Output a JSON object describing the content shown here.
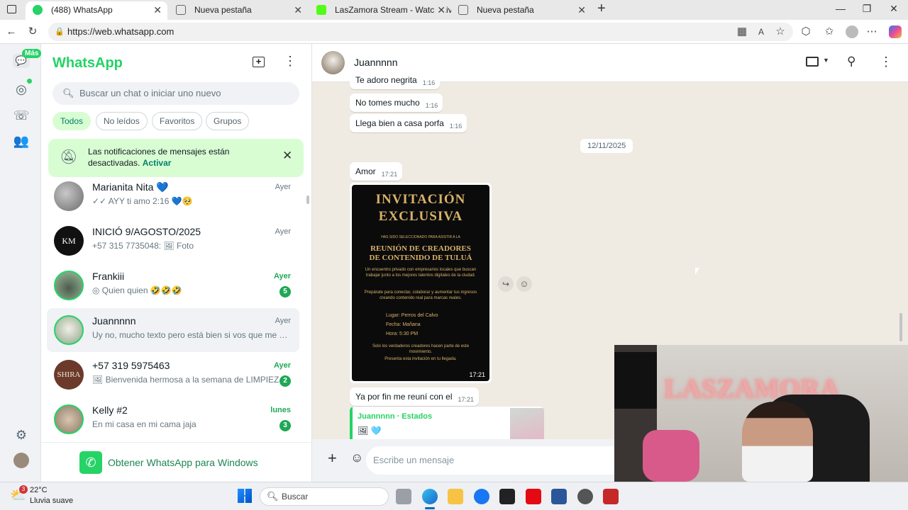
{
  "browser": {
    "tabs": [
      {
        "title": "(488) WhatsApp",
        "active": true,
        "favicon": "whatsapp-favicon"
      },
      {
        "title": "Nueva pestaña",
        "active": false,
        "favicon": "edge-page-favicon"
      },
      {
        "title": "LasZamora Stream - Watch Live o",
        "active": false,
        "favicon": "kick-favicon"
      },
      {
        "title": "Nueva pestaña",
        "active": false,
        "favicon": "edge-page-favicon"
      }
    ],
    "new_tab_label": "+",
    "url": "https://web.whatsapp.com"
  },
  "rail": {
    "mas_badge": "Más"
  },
  "sidebar": {
    "brand": "WhatsApp",
    "search_placeholder": "Buscar un chat o iniciar uno nuevo",
    "filters": [
      "Todos",
      "No leídos",
      "Favoritos",
      "Grupos"
    ],
    "notification": {
      "text": "Las notificaciones de mensajes están desactivadas.",
      "action": "Activar"
    },
    "chats": [
      {
        "name": "Marianita Nita 💙",
        "preview": "✓✓ AYY ti amo 2:16 💙🥺",
        "time": "Ayer",
        "unread": null,
        "selected": false,
        "avatar_color": "#8a8a8a"
      },
      {
        "name": "INICIÓ 9/AGOSTO/2025",
        "preview": "+57 315 7735048: 🖼 Foto",
        "time": "Ayer",
        "unread": null,
        "selected": false,
        "avatar_color": "#111111"
      },
      {
        "name": "Frankiii",
        "preview": "◎ Quien quien 🤣🤣🤣",
        "time": "Ayer",
        "unread": "5",
        "selected": false,
        "avatar_color": "#6d8b74"
      },
      {
        "name": "Juannnnn",
        "preview": "Uy no, mucho texto pero está bien si vos que me co...",
        "time": "Ayer",
        "unread": null,
        "selected": true,
        "avatar_color": "#a7b8a0"
      },
      {
        "name": "+57 319 5975463",
        "preview": "🖼 Bienvenida hermosa a la semana de LIMPIEZA…",
        "time": "Ayer",
        "unread": "2",
        "selected": false,
        "avatar_color": "#6b3a2a"
      },
      {
        "name": "Kelly #2",
        "preview": "En mi casa en mi cama jaja",
        "time": "lunes",
        "unread": "3",
        "selected": false,
        "avatar_color": "#b8a48a"
      }
    ],
    "get_app": "Obtener WhatsApp para Windows"
  },
  "conversation": {
    "contact": "Juannnnn",
    "messages": [
      {
        "text": "Te adoro negrita",
        "time": "1:16"
      },
      {
        "text": "No tomes mucho",
        "time": "1:16"
      },
      {
        "text": "Llega bien a casa porfa",
        "time": "1:16"
      }
    ],
    "date_divider": "12/11/2025",
    "amor": {
      "text": "Amor",
      "time": "17:21"
    },
    "flyer": {
      "title1": "INVITACIÓN",
      "title2": "EXCLUSIVA",
      "line1": "HAS SIDO SELECCIONADO PARA ASISTIR A LA",
      "heading1": "REUNIÓN DE CREADORES",
      "heading2": "DE CONTENIDO DE TULUÁ",
      "para1": "Un encuentro privado con empresarios locales que buscan trabajar junto a los mejores talentos digitales de la ciudad.",
      "para2": "Prepárate para conectar, colaborar y aumentar tus ingresos creando contenido real para marcas reales.",
      "lugar": "Lugar: Perros del Calvo",
      "fecha": "Fecha: Mañana",
      "hora": "Hora: 5:30 PM",
      "para3": "Solo los verdaderos creadores hacen parte de este movimiento.",
      "para4": "Presenta esta invitación en tu llegada.",
      "time": "17:21"
    },
    "after": {
      "text": "Ya por fin me reuní con el",
      "time": "17:21"
    },
    "reply": {
      "label": "Juannnnn · Estados",
      "content": "🖼 🩵"
    },
    "composer_placeholder": "Escribe un mensaje"
  },
  "stream": {
    "sign": "LASZAMORA"
  },
  "taskbar": {
    "temp": "22°C",
    "weather": "Lluvia suave",
    "weather_badge": "3",
    "search": "Buscar"
  },
  "colors": {
    "whatsapp_green": "#25d366",
    "accent_dark": "#008069",
    "unread": "#1fa855"
  }
}
